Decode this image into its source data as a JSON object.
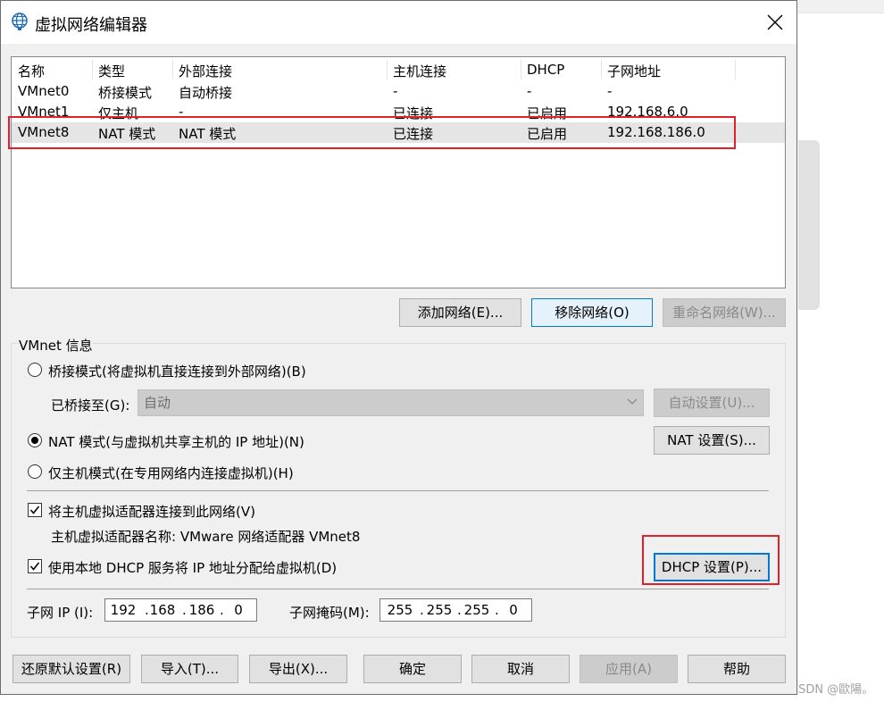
{
  "dialog": {
    "title": "虚拟网络编辑器"
  },
  "list": {
    "columns": [
      "名称",
      "类型",
      "外部连接",
      "主机连接",
      "DHCP",
      "子网地址"
    ],
    "rows": [
      [
        "VMnet0",
        "桥接模式",
        "自动桥接",
        "-",
        "-",
        "-"
      ],
      [
        "VMnet1",
        "仅主机...",
        "-",
        "已连接",
        "已启用",
        "192.168.6.0"
      ],
      [
        "VMnet8",
        "NAT 模式",
        "NAT 模式",
        "已连接",
        "已启用",
        "192.168.186.0"
      ]
    ],
    "selected_row": 2
  },
  "list_buttons": {
    "add": "添加网络(E)...",
    "remove": "移除网络(O)",
    "rename": "重命名网络(W)..."
  },
  "vmnet_info": {
    "group_label": "VMnet 信息",
    "bridged_label": "桥接模式(将虚拟机直接连接到外部网络)(B)",
    "bridged_to_label": "已桥接至(G):",
    "bridged_to_value": "自动",
    "auto_settings": "自动设置(U)...",
    "nat_label": "NAT 模式(与虚拟机共享主机的 IP 地址)(N)",
    "nat_settings": "NAT 设置(S)...",
    "hostonly_label": "仅主机模式(在专用网络内连接虚拟机)(H)",
    "selected_mode": "nat",
    "connect_adapter_label": "将主机虚拟适配器连接到此网络(V)",
    "connect_adapter_checked": true,
    "adapter_name_text": "主机虚拟适配器名称: VMware 网络适配器 VMnet8",
    "use_dhcp_label": "使用本地 DHCP 服务将 IP 地址分配给虚拟机(D)",
    "use_dhcp_checked": true,
    "dhcp_settings": "DHCP 设置(P)...",
    "subnet_ip_label": "子网 IP (I):",
    "subnet_ip": [
      "192",
      "168",
      "186",
      "0"
    ],
    "subnet_mask_label": "子网掩码(M):",
    "subnet_mask": [
      "255",
      "255",
      "255",
      "0"
    ]
  },
  "footer_buttons": {
    "restore": "还原默认设置(R)",
    "import": "导入(T)...",
    "export": "导出(X)...",
    "ok": "确定",
    "cancel": "取消",
    "apply": "应用(A)",
    "help": "帮助"
  },
  "watermark": "CSDN @歐陽。",
  "colors": {
    "highlight_box": "#e0202a",
    "focus_blue": "#0078d7"
  }
}
